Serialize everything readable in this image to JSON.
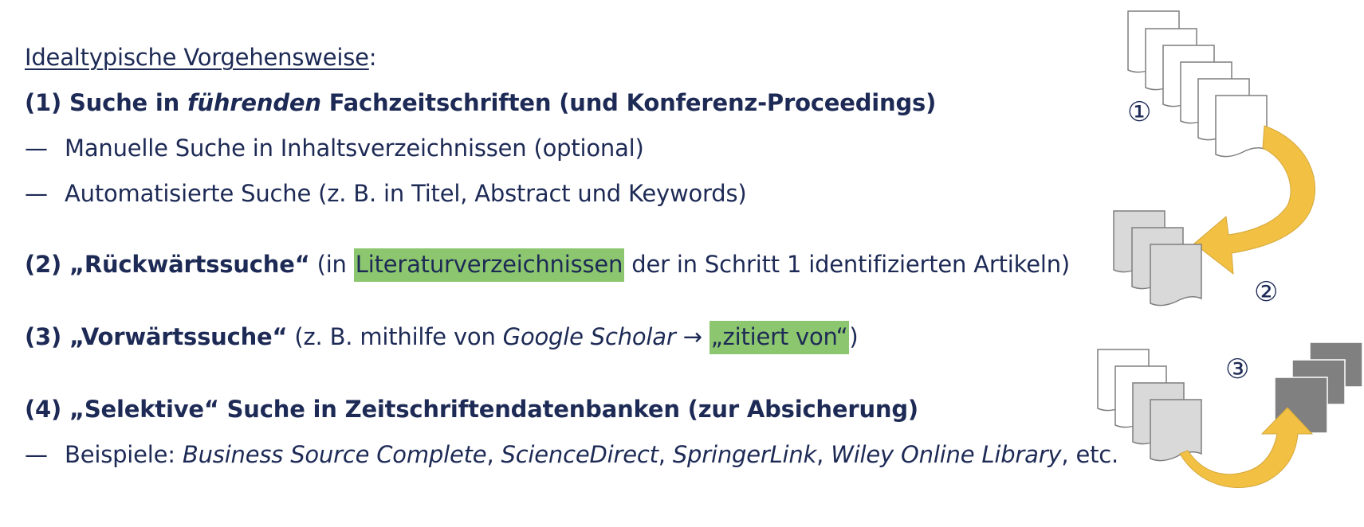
{
  "heading": {
    "underlined": "Idealtypische Vorgehensweise",
    "colon": ":"
  },
  "step1": {
    "prefix": "(1) Suche in ",
    "emph": "führenden",
    "suffix": " Fachzeitschriften (und Konferenz-Proceedings)",
    "bullets": [
      {
        "dash": "—",
        "text": "Manuelle Suche in Inhaltsverzeichnissen (optional)"
      },
      {
        "dash": "—",
        "text": "Automatisierte Suche (z. B. in Titel, Abstract und Keywords)"
      }
    ]
  },
  "step2": {
    "bold": "(2) „Rückwärtssuche“",
    "pre": " (in ",
    "highlight": "Literaturverzeichnissen",
    "post": " der in Schritt 1 identifizierten Artikeln)"
  },
  "step3": {
    "bold": "(3) „Vorwärtssuche“",
    "pre": " (z. B. mithilfe von ",
    "italic": "Google Scholar",
    "arrow": " → ",
    "highlight": "„zitiert von“",
    "post": ")"
  },
  "step4": {
    "bold": "(4) „Selektive“ Suche in Zeitschriftendatenbanken (zur Absicherung)",
    "bullet": {
      "dash": "—",
      "lead": "Beispiele: ",
      "db1": "Business Source Complete",
      "sep1": ", ",
      "db2": "ScienceDirect",
      "sep2": ", ",
      "db3": "SpringerLink",
      "sep3": ", ",
      "db4": "Wiley Online Library",
      "tail": ", etc."
    }
  },
  "diagram": {
    "label1": "①",
    "label2": "②",
    "label3": "③",
    "colors": {
      "arrow": "#f2c144",
      "arrow_dark": "#c9a035",
      "doc_white": "#ffffff",
      "doc_light": "#d9d9d9",
      "doc_dark": "#808080"
    }
  }
}
